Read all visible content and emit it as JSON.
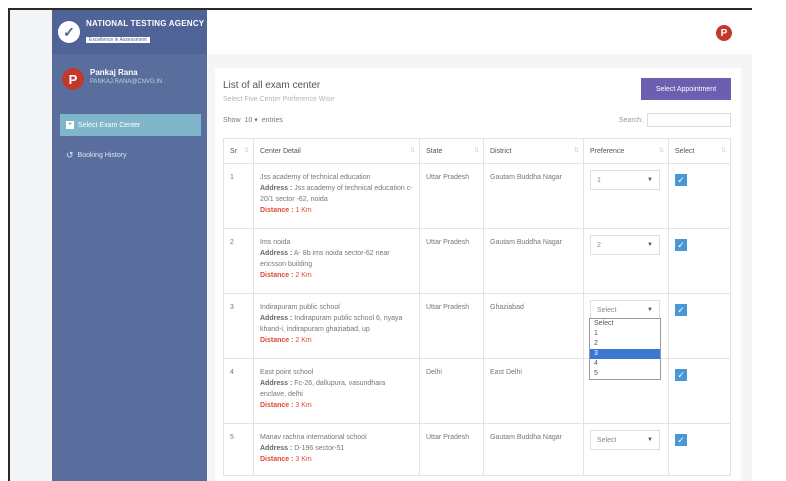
{
  "brand": {
    "name": "NATIONAL TESTING AGENCY",
    "tagline": "Excellence in Assessment"
  },
  "user": {
    "name": "Pankaj Rana",
    "email": "PANKAJ.RANA@CNVG.IN",
    "initial": "P"
  },
  "nav": {
    "active": "Select Exam Center",
    "items": [
      {
        "label": "Booking History"
      }
    ]
  },
  "page": {
    "title": "List of all exam center",
    "subtitle": "Select Five Center Preference Wise",
    "button": "Select Appointment"
  },
  "controls": {
    "show_label": "Show",
    "entries_value": "10",
    "entries_label": "entries",
    "search_label": "Search:"
  },
  "table": {
    "headers": [
      "Sr",
      "Center Detail",
      "State",
      "District",
      "Preference",
      "Select"
    ],
    "address_label": "Address :",
    "distance_label": "Distance :",
    "rows": [
      {
        "sr": "1",
        "name": "Jss academy of technical education",
        "address": "Jss academy of technical education c-20/1 sector -62, noida",
        "distance": "1 Km",
        "state": "Uttar Pradesh",
        "district": "Gautam Buddha Nagar",
        "preference": "1"
      },
      {
        "sr": "2",
        "name": "Ims noida",
        "address": "A- 8b ims noida sector-62 near ericsson building",
        "distance": "2 Km",
        "state": "Uttar Pradesh",
        "district": "Gautam Buddha Nagar",
        "preference": "2"
      },
      {
        "sr": "3",
        "name": "Indirapuram public school",
        "address": "Indirapuram public school 6, nyaya khand-i, indirapuram ghaziabad, up",
        "distance": "2 Km",
        "state": "Uttar Pradesh",
        "district": "Ghaziabad",
        "preference": "Select"
      },
      {
        "sr": "4",
        "name": "East point school",
        "address": "Fc-26, dallupura, vasundhara enclave, delhi",
        "distance": "3 Km",
        "state": "Delhi",
        "district": "East Delhi",
        "preference": ""
      },
      {
        "sr": "5",
        "name": "Manav rachna international school",
        "address": "D-196 sector-51",
        "distance": "3 Km",
        "state": "Uttar Pradesh",
        "district": "Gautam Buddha Nagar",
        "preference": "Select"
      }
    ]
  },
  "dropdown": {
    "options": [
      "Select",
      "1",
      "2",
      "3",
      "4",
      "5"
    ],
    "highlighted": "3"
  },
  "colors": {
    "sidebar": "#5a6e9e",
    "accent_button": "#6c5fb0",
    "active_nav": "#7fb6c9",
    "checkbox": "#4a97d4",
    "distance": "#e04b3a"
  }
}
